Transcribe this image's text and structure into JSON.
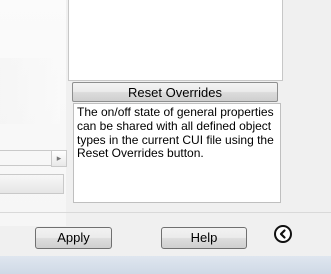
{
  "panel": {
    "reset_button_label": "Reset Overrides",
    "description": "The on/off state of general properties can be shared with all defined object types in the current CUI file using the Reset Overrides button."
  },
  "footer": {
    "apply_label": "Apply",
    "help_label": "Help"
  },
  "icons": {
    "scroll_arrow": "arrow-right-icon",
    "collapse": "chevron-left-circle-icon"
  }
}
